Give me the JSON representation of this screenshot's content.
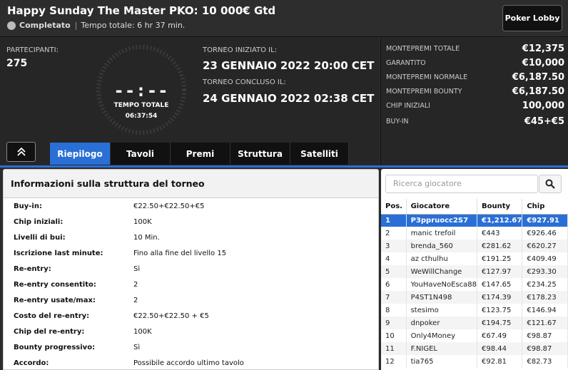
{
  "header": {
    "title": "Happy Sunday The Master PKO: 10 000€ Gtd",
    "status": "Completato",
    "separator": "|",
    "total_time_text": "Tempo totale: 6 hr 37 min.",
    "lobby_button": "Poker Lobby"
  },
  "summary": {
    "participants_label": "PARTECIPANTI:",
    "participants_value": "275",
    "clock_digits": "--:--",
    "clock_label": "TEMPO TOTALE",
    "clock_time": "06:37:54",
    "started_label": "TORNEO INIZIATO IL:",
    "started_value": "23 GENNAIO 2022   20:00 CET",
    "ended_label": "TORNEO CONCLUSO IL:",
    "ended_value": "24 GENNAIO 2022   02:38 CET"
  },
  "prizes": [
    {
      "label": "MONTEPREMI TOTALE",
      "value": "€12,375"
    },
    {
      "label": "GARANTITO",
      "value": "€10,000"
    },
    {
      "label": "MONTEPREMI NORMALE",
      "value": "€6,187.50"
    },
    {
      "label": "MONTEPREMI BOUNTY",
      "value": "€6,187.50"
    },
    {
      "label": "CHIP INIZIALI",
      "value": "100,000"
    },
    {
      "label": "BUY-IN",
      "value": "€45+€5"
    }
  ],
  "tabs": [
    {
      "label": "Riepilogo",
      "active": true
    },
    {
      "label": "Tavoli",
      "active": false
    },
    {
      "label": "Premi",
      "active": false
    },
    {
      "label": "Struttura",
      "active": false
    },
    {
      "label": "Satelliti",
      "active": false
    }
  ],
  "structure": {
    "heading": "Informazioni sulla struttura del torneo",
    "rows": [
      {
        "label": "Buy-in:",
        "value": "€22.50+€22.50+€5"
      },
      {
        "label": "Chip iniziali:",
        "value": "100K"
      },
      {
        "label": "Livelli di bui:",
        "value": "10 Min."
      },
      {
        "label": "Iscrizione last minute:",
        "value": "Fino alla fine del livello 15"
      },
      {
        "label": "Re-entry:",
        "value": "Sì"
      },
      {
        "label": "Re-entry consentito:",
        "value": "2"
      },
      {
        "label": "Re-entry usate/max:",
        "value": "2"
      },
      {
        "label": "Costo del re-entry:",
        "value": "€22.50+€22.50 + €5"
      },
      {
        "label": "Chip del re-entry:",
        "value": "100K"
      },
      {
        "label": "Bounty progressivo:",
        "value": "Sì"
      },
      {
        "label": "Accordo:",
        "value": "Possibile accordo ultimo tavolo"
      }
    ]
  },
  "players": {
    "search_placeholder": "Ricerca giocatore",
    "columns": [
      "Pos.",
      "Giocatore",
      "Bounty",
      "Chip"
    ],
    "rows": [
      {
        "pos": "1",
        "name": "P3ppruocc2S7",
        "bounty": "€1,212.67",
        "chip": "€927.91",
        "selected": true
      },
      {
        "pos": "2",
        "name": "manic trefoil",
        "bounty": "€443",
        "chip": "€926.46"
      },
      {
        "pos": "3",
        "name": "brenda_560",
        "bounty": "€281.62",
        "chip": "€620.27"
      },
      {
        "pos": "4",
        "name": "az cthulhu",
        "bounty": "€191.25",
        "chip": "€409.49"
      },
      {
        "pos": "5",
        "name": "WeWillChange",
        "bounty": "€127.97",
        "chip": "€293.30"
      },
      {
        "pos": "6",
        "name": "YouHaveNoEsca88",
        "bounty": "€147.65",
        "chip": "€234.25"
      },
      {
        "pos": "7",
        "name": "P4ST1N498",
        "bounty": "€174.39",
        "chip": "€178.23"
      },
      {
        "pos": "8",
        "name": "stesimo",
        "bounty": "€123.75",
        "chip": "€146.94"
      },
      {
        "pos": "9",
        "name": "dnpoker",
        "bounty": "€194.75",
        "chip": "€121.67"
      },
      {
        "pos": "10",
        "name": "Only4Money",
        "bounty": "€67.49",
        "chip": "€98.87"
      },
      {
        "pos": "11",
        "name": "F.NIGEL",
        "bounty": "€98.44",
        "chip": "€98.87"
      },
      {
        "pos": "12",
        "name": "tia765",
        "bounty": "€92.81",
        "chip": "€82.73"
      }
    ]
  },
  "colors": {
    "accent": "#2a6fd6",
    "background": "#2b2b2b",
    "panel": "#262626"
  },
  "icons": {
    "status": "status-dot-icon",
    "collapse": "chevron-up-double-icon",
    "search": "search-icon"
  }
}
